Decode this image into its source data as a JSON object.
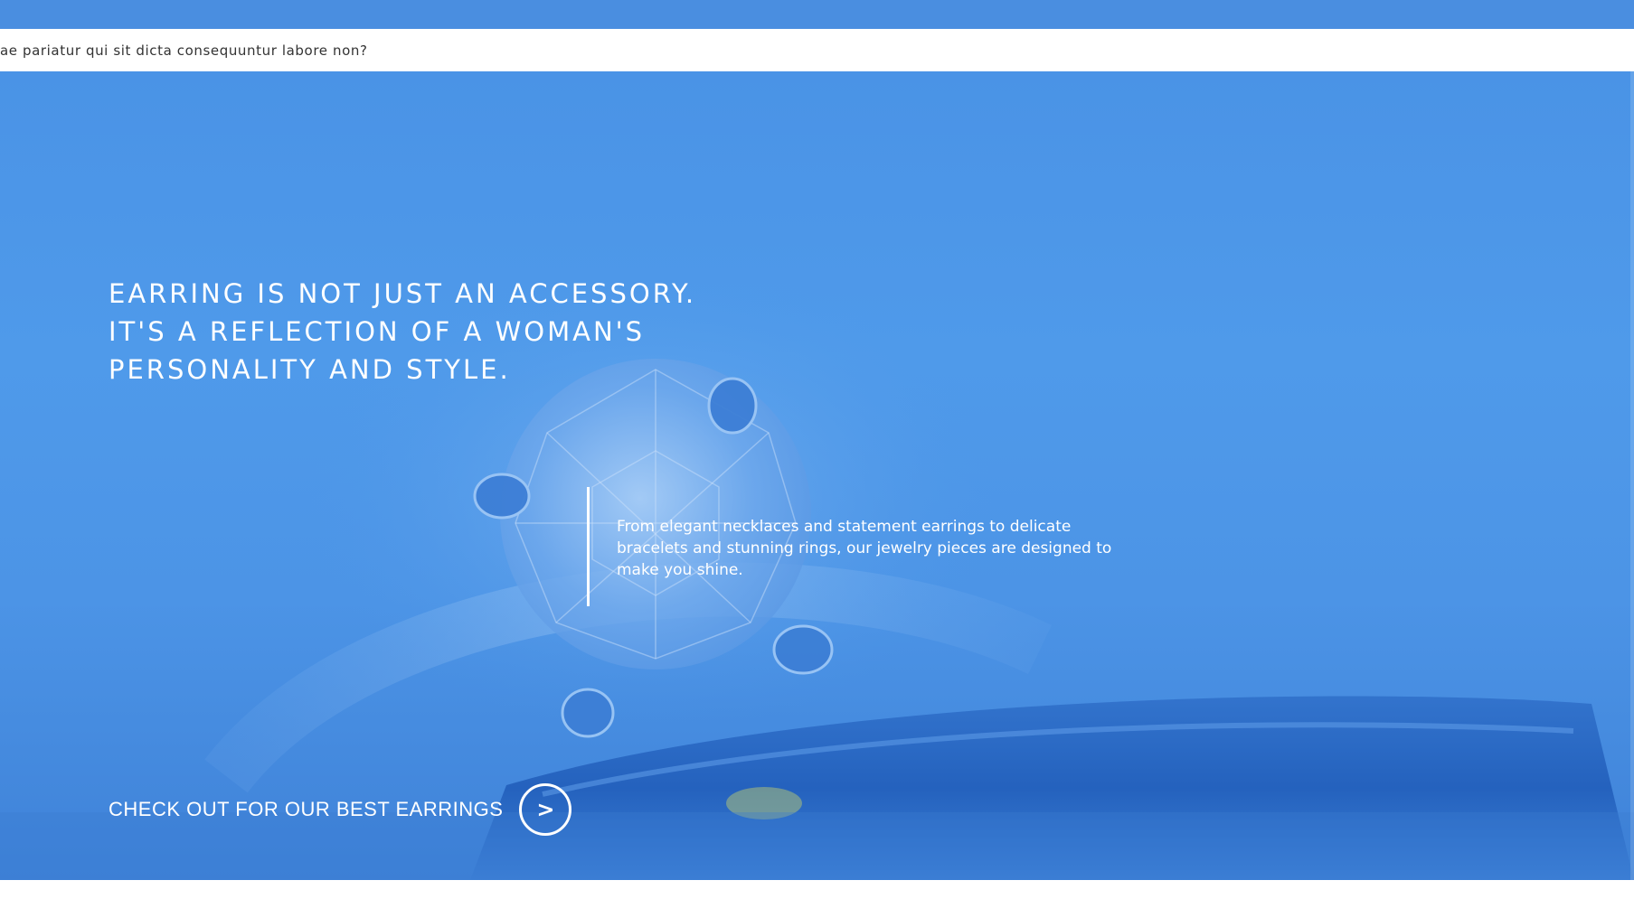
{
  "ticker": {
    "text": "ae pariatur qui sit dicta consequuntur labore non?"
  },
  "hero": {
    "headline_lines": [
      "EARRING IS NOT JUST AN ACCESSORY.",
      "IT'S A REFLECTION OF A WOMAN'S",
      "PERSONALITY AND STYLE."
    ],
    "description": "From elegant necklaces and statement earrings to delicate bracelets and stunning rings, our jewelry pieces are designed to make you shine.",
    "cta_label": "CHECK OUT FOR OUR BEST EARRINGS",
    "cta_arrow": ">",
    "background_image": "diamond-ring-photo"
  },
  "colors": {
    "top_bar": "#4a8ee0",
    "hero_tint": "#4f9aea",
    "text": "#ffffff"
  }
}
